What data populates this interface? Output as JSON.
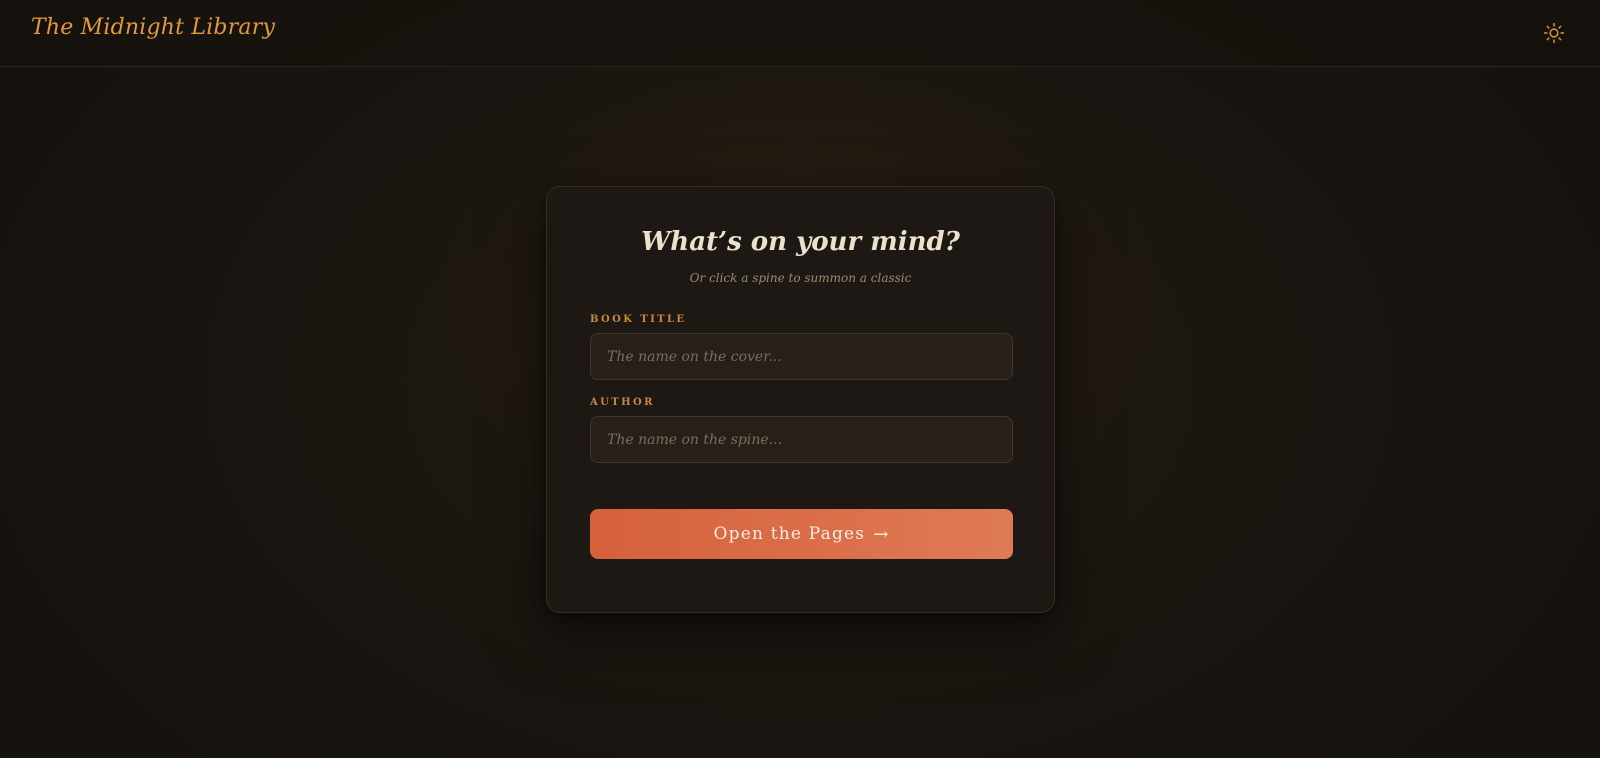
{
  "header": {
    "brand": "The Midnight Library",
    "theme_icon": "sun-icon"
  },
  "card": {
    "title": "What’s on your mind?",
    "subtitle": "Or click a spine to summon a classic",
    "fields": {
      "title_label": "BOOK TITLE",
      "title_placeholder": "The name on the cover...",
      "author_label": "AUTHOR",
      "author_placeholder": "The name on the spine..."
    },
    "submit_label": "Open the Pages",
    "submit_arrow": "→"
  },
  "colors": {
    "accent": "#e19a3a",
    "button": "#d5613a",
    "background": "#1a1511"
  }
}
